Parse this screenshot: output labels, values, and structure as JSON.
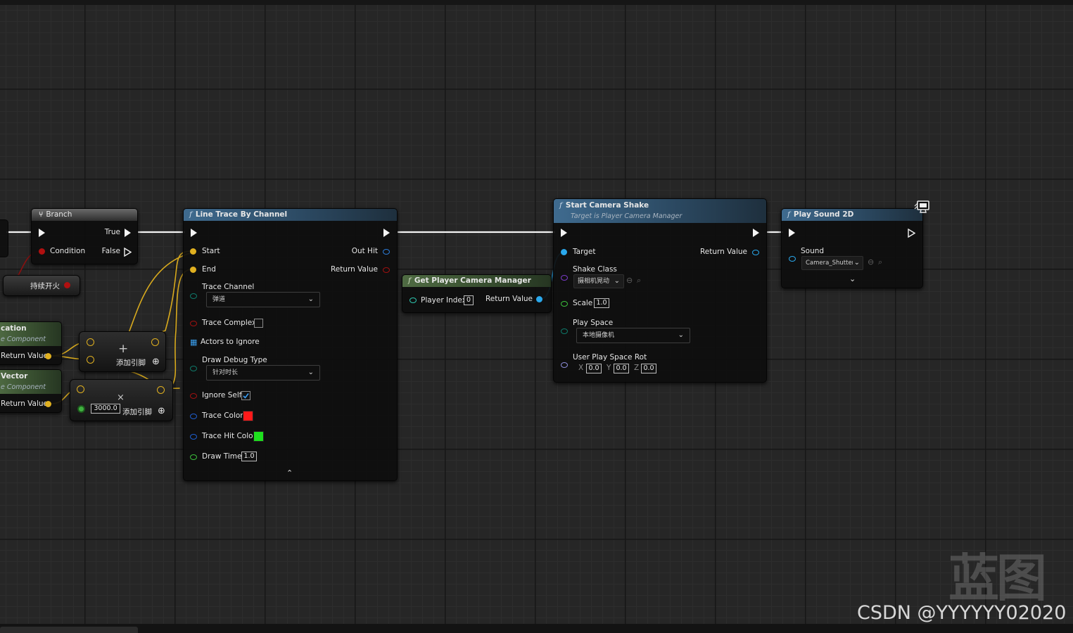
{
  "branch": {
    "title": "Branch",
    "true_label": "True",
    "false_label": "False",
    "condition_label": "Condition"
  },
  "variable_node": {
    "label": "持续开火"
  },
  "left_nodes": {
    "node1_title": "cation",
    "node1_sub": "e Component",
    "node1_return": "Return Value",
    "node2_title": "Vector",
    "node2_sub": "e Component",
    "node2_return": "Return Value"
  },
  "add_node": {
    "label": "添加引脚",
    "plus": "+",
    "add_pin": "⊕"
  },
  "mul_node": {
    "label": "添加引脚",
    "cross": "×",
    "value": "3000.0",
    "add_pin": "⊕"
  },
  "line_trace": {
    "title": "Line Trace By Channel",
    "start": "Start",
    "end": "End",
    "out_hit": "Out Hit",
    "return_value": "Return Value",
    "trace_channel": "Trace Channel",
    "trace_channel_value": "弹道",
    "trace_complex": "Trace Complex",
    "actors_to_ignore": "Actors to Ignore",
    "draw_debug_type": "Draw Debug Type",
    "draw_debug_value": "针对时长",
    "ignore_self": "Ignore Self",
    "trace_color": "Trace Color",
    "trace_hit_color": "Trace Hit Color",
    "draw_time": "Draw Time",
    "draw_time_value": "1.0",
    "trace_color_hex": "#ff1a1a",
    "trace_hit_color_hex": "#1ee01e"
  },
  "camera_manager": {
    "title": "Get Player Camera Manager",
    "player_index": "Player Index",
    "player_index_value": "0",
    "return_value": "Return Value"
  },
  "camera_shake": {
    "title": "Start Camera Shake",
    "subtitle": "Target is Player Camera Manager",
    "target": "Target",
    "return_value": "Return Value",
    "shake_class": "Shake Class",
    "shake_class_value": "摄相机晃动",
    "scale": "Scale",
    "scale_value": "1.0",
    "play_space": "Play Space",
    "play_space_value": "本地摄像机",
    "user_play_space_rot": "User Play Space Rot",
    "x_label": "X",
    "x_value": "0.0",
    "y_label": "Y",
    "y_value": "0.0",
    "z_label": "Z",
    "z_value": "0.0"
  },
  "play_sound": {
    "title": "Play Sound 2D",
    "sound": "Sound",
    "sound_value": "Camera_Shutter"
  },
  "watermark": {
    "big": "蓝图",
    "credit": "CSDN @YYYYYY02020"
  }
}
